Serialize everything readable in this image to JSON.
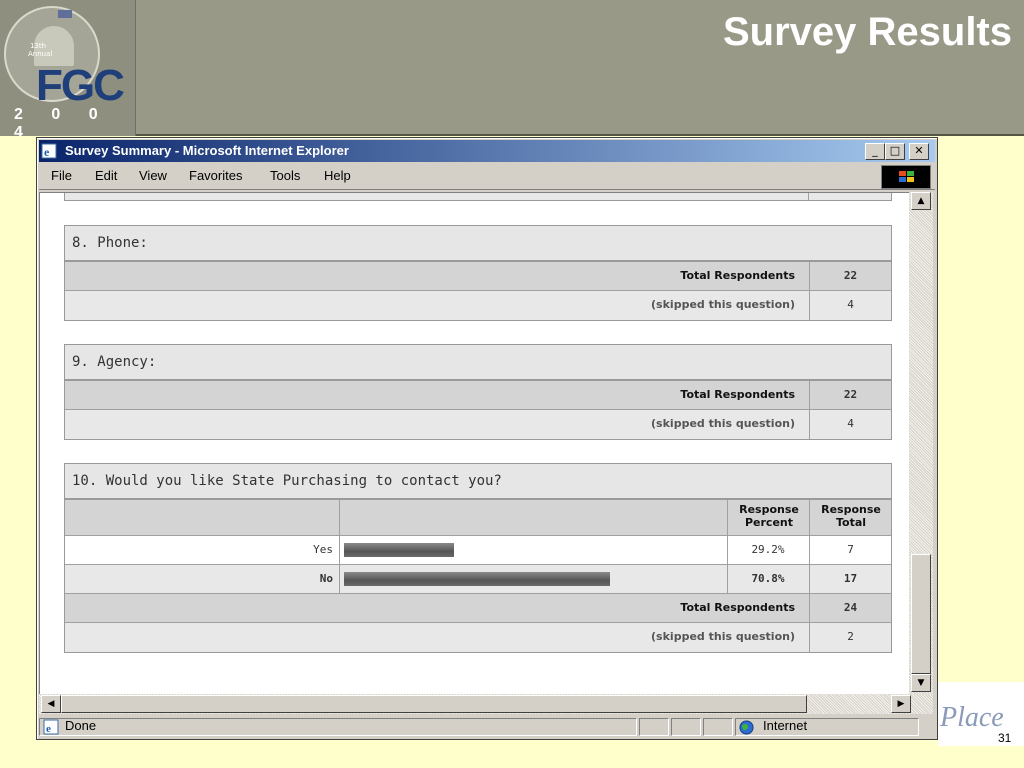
{
  "slide": {
    "title": "Survey Results",
    "number": "31",
    "footer_logo_text": "Place",
    "logo": {
      "text": "FGC",
      "year": "2 0 0 4",
      "annual": "13th Annual"
    }
  },
  "window": {
    "title": "Survey Summary - Microsoft Internet Explorer",
    "buttons": {
      "minimize": "_",
      "maximize": "□",
      "close": "✕"
    }
  },
  "menu": [
    "File",
    "Edit",
    "View",
    "Favorites",
    "Tools",
    "Help"
  ],
  "questions": [
    {
      "title": "8. Phone:",
      "total_label": "Total Respondents",
      "total": "22",
      "skipped_label": "(skipped this question)",
      "skipped": "4"
    },
    {
      "title": "9. Agency:",
      "total_label": "Total Respondents",
      "total": "22",
      "skipped_label": "(skipped this question)",
      "skipped": "4"
    },
    {
      "title": "10. Would you like State Purchasing to contact you?",
      "header_percent": "Response Percent",
      "header_total": "Response Total",
      "answers": [
        {
          "label": "Yes",
          "percent": "29.2%",
          "total": "7",
          "share": 29.2
        },
        {
          "label": "No",
          "percent": "70.8%",
          "total": "17",
          "share": 70.8
        }
      ],
      "total_label": "Total Respondents",
      "total": "24",
      "skipped_label": "(skipped this question)",
      "skipped": "2"
    }
  ],
  "statusbar": {
    "left": "Done",
    "zone": "Internet"
  },
  "icons": [
    "ie-icon",
    "windows-logo-icon",
    "scroll-up-icon",
    "scroll-down-icon",
    "scroll-left-icon",
    "scroll-right-icon",
    "done-page-icon",
    "globe-icon"
  ]
}
